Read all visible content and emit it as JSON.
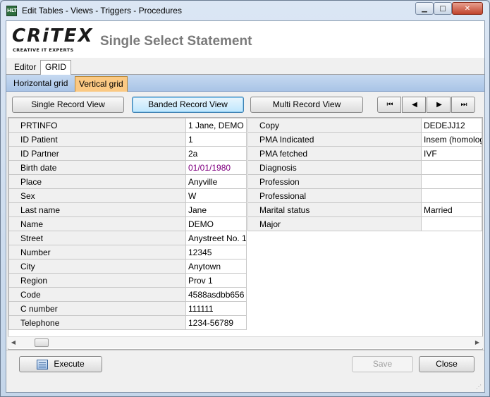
{
  "window": {
    "title": "Edit Tables - Views - Triggers - Procedures",
    "app_icon_text": "HLT"
  },
  "logo": {
    "main": "CRiTEX",
    "sub": "CREATIVE IT EXPERTS"
  },
  "header": {
    "title": "Single Select Statement"
  },
  "tabs": [
    {
      "label": "Editor"
    },
    {
      "label": "GRID"
    }
  ],
  "subtabs": [
    {
      "label": "Horizontal grid"
    },
    {
      "label": "Vertical grid"
    }
  ],
  "view_buttons": {
    "single": "Single Record View",
    "banded": "Banded Record View",
    "multi": "Multi Record View"
  },
  "nav": {
    "first": "⏮",
    "prev": "◀",
    "next": "▶",
    "last": "⏭"
  },
  "grid_left": [
    {
      "label": "PRTINFO",
      "value": "1 Jane, DEMO"
    },
    {
      "label": "ID Patient",
      "value": "1"
    },
    {
      "label": "ID Partner",
      "value": "2a"
    },
    {
      "label": "Birth date",
      "value": "01/01/1980"
    },
    {
      "label": "Place",
      "value": "Anyville"
    },
    {
      "label": "Sex",
      "value": "W"
    },
    {
      "label": "Last name",
      "value": "Jane"
    },
    {
      "label": "Name",
      "value": "DEMO"
    },
    {
      "label": "Street",
      "value": "Anystreet No. 1"
    },
    {
      "label": "Number",
      "value": "12345"
    },
    {
      "label": "City",
      "value": "Anytown"
    },
    {
      "label": "Region",
      "value": "Prov 1"
    },
    {
      "label": "Code",
      "value": "4588asdbb656"
    },
    {
      "label": "C number",
      "value": "111111"
    },
    {
      "label": "Telephone",
      "value": "1234-56789"
    }
  ],
  "grid_right": [
    {
      "label": "Copy",
      "value": "DEDEJJ12"
    },
    {
      "label": "PMA Indicated",
      "value": "Insem (homolog"
    },
    {
      "label": "PMA fetched",
      "value": "IVF"
    },
    {
      "label": "Diagnosis",
      "value": ""
    },
    {
      "label": "Profession",
      "value": ""
    },
    {
      "label": "Professional",
      "value": ""
    },
    {
      "label": "Marital status",
      "value": "Married"
    },
    {
      "label": "Major",
      "value": ""
    }
  ],
  "footer": {
    "execute": "Execute",
    "save": "Save",
    "close": "Close"
  },
  "colors": {
    "active_subtab": "#fbc983",
    "date_value": "#800080"
  }
}
